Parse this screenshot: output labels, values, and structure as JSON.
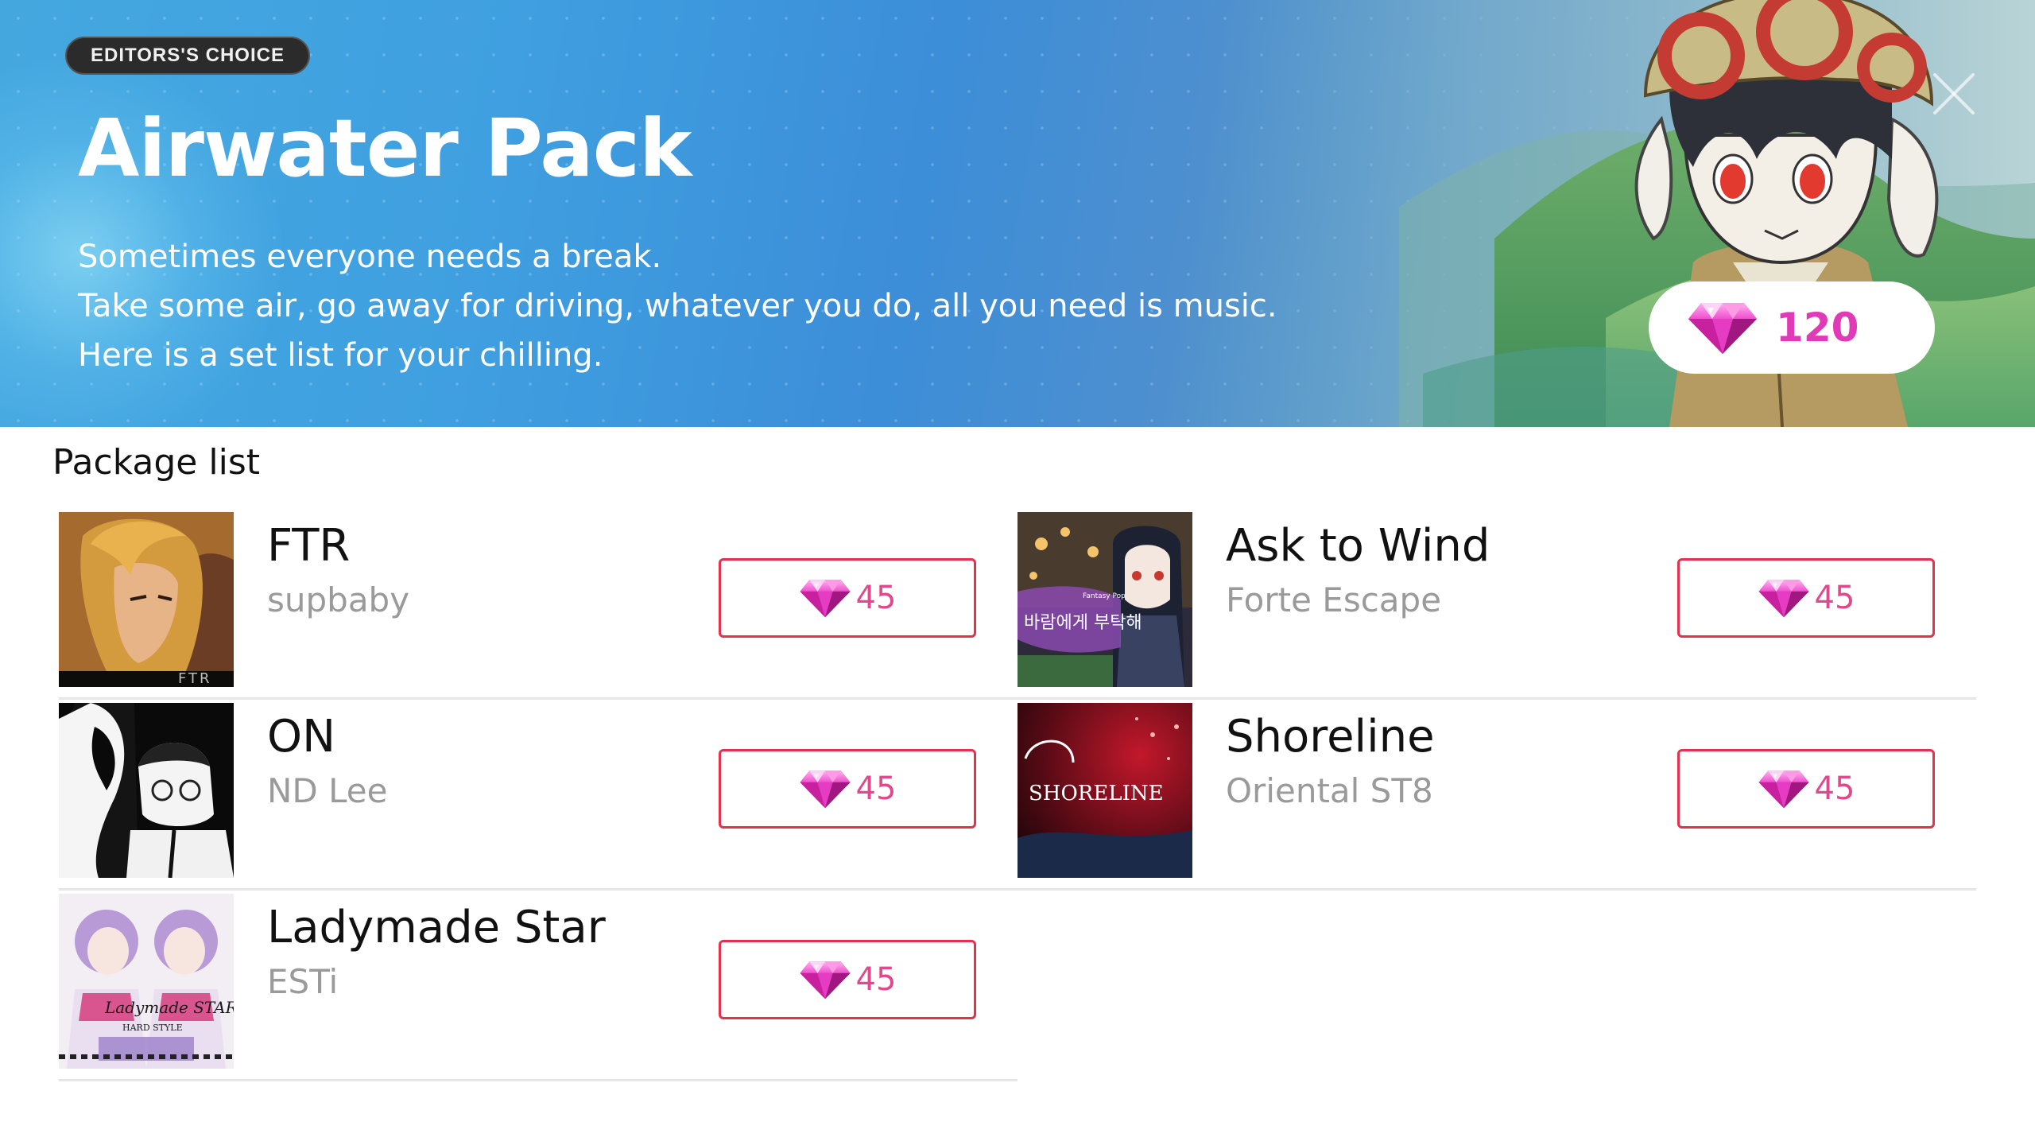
{
  "hero": {
    "badge": "EDITORS'S CHOICE",
    "title": "Airwater Pack",
    "description": [
      "Sometimes everyone needs a break.",
      "Take some air, go away for driving, whatever you do, all you need is music.",
      "Here is a set list for your chilling."
    ],
    "price": "120",
    "close_icon": "close-icon"
  },
  "section_title": "Package list",
  "packages": [
    {
      "name": "FTR",
      "artist": "supbaby",
      "price": "45"
    },
    {
      "name": "Ask to Wind",
      "artist": "Forte Escape",
      "price": "45",
      "cover_text": "바람에게 부탁해",
      "cover_subtext": "Fantasy Pop"
    },
    {
      "name": "ON",
      "artist": "ND Lee",
      "price": "45"
    },
    {
      "name": "Shoreline",
      "artist": "Oriental ST8",
      "price": "45",
      "cover_text": "SHORELINE"
    },
    {
      "name": "Ladymade Star",
      "artist": "ESTi",
      "price": "45",
      "cover_text": "Ladymade STAR",
      "cover_subtext": "HARD STYLE"
    }
  ],
  "colors": {
    "accent_pink": "#e03ab7",
    "button_border": "#e4324c",
    "gem_icon": "diamond-gem-icon"
  },
  "cover_labels": {
    "ftr": "FTR"
  }
}
